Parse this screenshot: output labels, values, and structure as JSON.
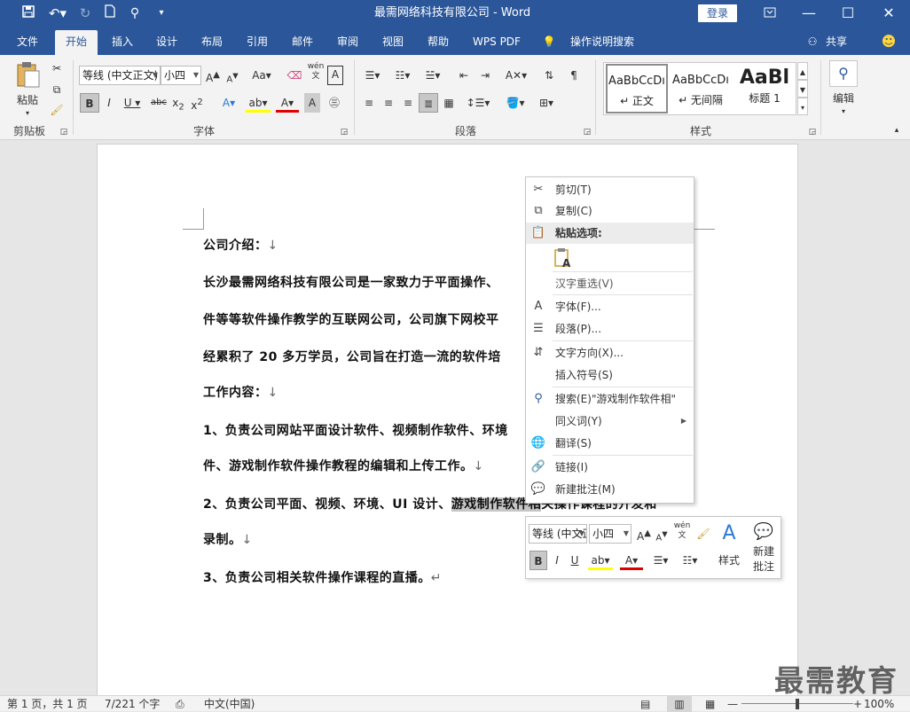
{
  "window": {
    "title": "最需网络科技有限公司  -  Word",
    "login_label": "登录",
    "qat_icons": [
      "save-icon",
      "undo-icon",
      "redo-icon",
      "new-doc-icon",
      "touch-mode-icon",
      "customize-icon"
    ]
  },
  "tabs": [
    {
      "label": "文件"
    },
    {
      "label": "开始"
    },
    {
      "label": "插入"
    },
    {
      "label": "设计"
    },
    {
      "label": "布局"
    },
    {
      "label": "引用"
    },
    {
      "label": "邮件"
    },
    {
      "label": "审阅"
    },
    {
      "label": "视图"
    },
    {
      "label": "帮助"
    },
    {
      "label": "WPS PDF"
    },
    {
      "label": "操作说明搜索"
    }
  ],
  "share_label": "共享",
  "ribbon": {
    "clipboard": {
      "label": "剪贴板",
      "paste_label": "粘贴"
    },
    "font": {
      "label": "字体",
      "font_name": "等线 (中文正文)",
      "font_size": "小四"
    },
    "paragraph": {
      "label": "段落"
    },
    "styles": {
      "label": "样式",
      "items": [
        {
          "preview": "AaBbCcDı",
          "name": "↵ 正文"
        },
        {
          "preview": "AaBbCcDı",
          "name": "↵ 无间隔"
        },
        {
          "preview": "AaBl",
          "name": "标题 1"
        }
      ]
    },
    "edit": {
      "label": "编辑"
    }
  },
  "document": {
    "paragraphs": [
      {
        "text": "公司介绍：",
        "mark": "↓"
      },
      {
        "text": "长沙最需网络科技有限公司是一家致力于平面操作、",
        "mark": ""
      },
      {
        "text": "件等等软件操作教学的互联网公司，公司旗下网校平",
        "mark": ""
      },
      {
        "text": "经累积了 20 多万学员，公司旨在打造一流的软件培",
        "mark": ""
      },
      {
        "text": "工作内容：",
        "mark": "↓"
      },
      {
        "text": "1、负责公司网站平面设计软件、视频制作软件、环境",
        "mark": ""
      },
      {
        "text": "件、游戏制作软件操作教程的编辑和上传工作。",
        "mark": "↓"
      },
      {
        "text_before": "2、负责公司平面、视频、环境、UI 设计、",
        "selected": "游戏制作软件相",
        "text_after": "关操作课程的开发和"
      },
      {
        "text": "录制。",
        "mark": "↓"
      },
      {
        "text": "3、负责公司相关软件操作课程的直播。",
        "mark": "↵"
      }
    ]
  },
  "context_menu": {
    "items": [
      {
        "icon": "cut-icon",
        "label": "剪切(T)"
      },
      {
        "icon": "copy-icon",
        "label": "复制(C)"
      },
      {
        "icon": "paste-icon",
        "label": "粘贴选项:"
      },
      {
        "icon": "keep-text-only-icon",
        "label": ""
      },
      {
        "icon": "",
        "label": "汉字重选(V)"
      },
      {
        "icon": "font-icon",
        "label": "字体(F)..."
      },
      {
        "icon": "paragraph-icon",
        "label": "段落(P)..."
      },
      {
        "icon": "text-direction-icon",
        "label": "文字方向(X)..."
      },
      {
        "icon": "",
        "label": "插入符号(S)"
      },
      {
        "icon": "search-icon",
        "label": "搜索(E)\"游戏制作软件相\""
      },
      {
        "icon": "",
        "label": "同义词(Y)"
      },
      {
        "icon": "translate-icon",
        "label": "翻译(S)"
      },
      {
        "icon": "link-icon",
        "label": "链接(I)"
      },
      {
        "icon": "new-comment-icon",
        "label": "新建批注(M)"
      }
    ]
  },
  "mini_toolbar": {
    "font_name": "等线 (中文正文)",
    "font_size": "小四",
    "styles_label": "样式",
    "new_comment_label_1": "新建",
    "new_comment_label_2": "批注"
  },
  "status": {
    "page": "第 1 页，共 1 页",
    "words": "7/221 个字",
    "lang": "中文(中国)",
    "zoom": "100%"
  },
  "watermark": "最需教育"
}
